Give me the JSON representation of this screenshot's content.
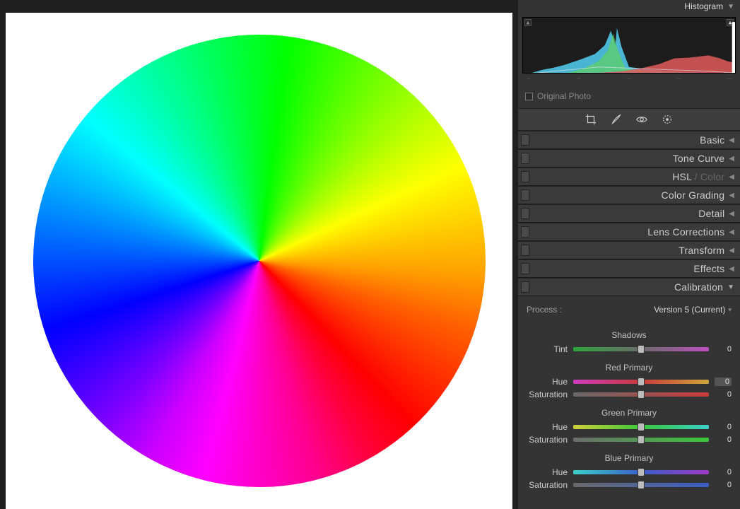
{
  "histogram": {
    "title": "Histogram",
    "tick": "–"
  },
  "originalPhoto": {
    "label": "Original Photo"
  },
  "tools": [
    {
      "name": "crop-icon"
    },
    {
      "name": "brush-icon"
    },
    {
      "name": "eye-icon"
    },
    {
      "name": "radial-icon"
    }
  ],
  "sections": [
    {
      "title": "Basic",
      "open": false
    },
    {
      "title": "Tone Curve",
      "open": false
    },
    {
      "titleHtml": true,
      "t1": "HSL",
      "sep": " / ",
      "t2": "Color",
      "open": false
    },
    {
      "title": "Color Grading",
      "open": false
    },
    {
      "title": "Detail",
      "open": false
    },
    {
      "title": "Lens Corrections",
      "open": false
    },
    {
      "title": "Transform",
      "open": false
    },
    {
      "title": "Effects",
      "open": false
    },
    {
      "title": "Calibration",
      "open": true
    }
  ],
  "calibration": {
    "processLabel": "Process :",
    "processValue": "Version 5 (Current)",
    "shadows": {
      "title": "Shadows",
      "tint": {
        "label": "Tint",
        "value": "0"
      }
    },
    "red": {
      "title": "Red Primary",
      "hue": {
        "label": "Hue",
        "value": "0",
        "active": true
      },
      "sat": {
        "label": "Saturation",
        "value": "0"
      }
    },
    "green": {
      "title": "Green Primary",
      "hue": {
        "label": "Hue",
        "value": "0"
      },
      "sat": {
        "label": "Saturation",
        "value": "0"
      }
    },
    "blue": {
      "title": "Blue Primary",
      "hue": {
        "label": "Hue",
        "value": "0"
      },
      "sat": {
        "label": "Saturation",
        "value": "0"
      }
    }
  }
}
